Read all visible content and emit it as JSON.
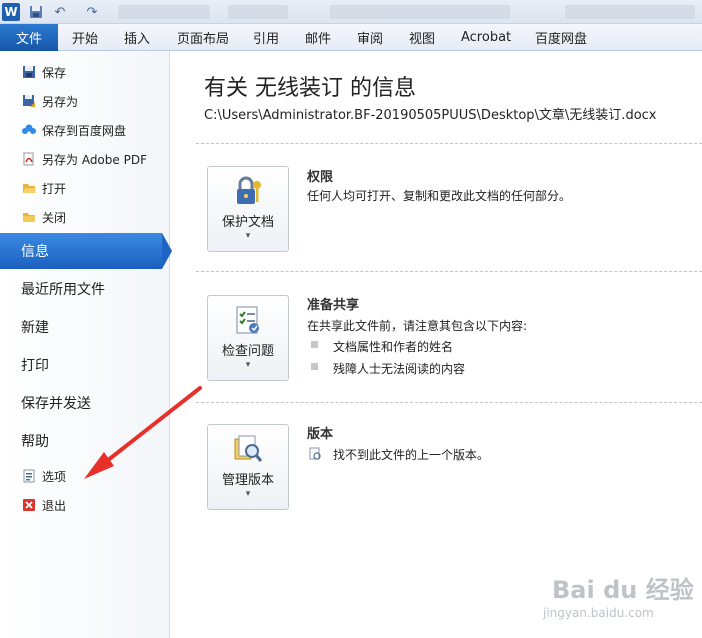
{
  "titlebar": {
    "app_icon": "W",
    "undo_glyph": "↶",
    "redo_glyph": "↷"
  },
  "ribbon": {
    "file_tab": "文件",
    "tabs": [
      "开始",
      "插入",
      "页面布局",
      "引用",
      "邮件",
      "审阅",
      "视图",
      "Acrobat",
      "百度网盘"
    ]
  },
  "nav": {
    "commands_top": [
      {
        "label": "保存",
        "icon": "save-icon"
      },
      {
        "label": "另存为",
        "icon": "save-as-icon"
      },
      {
        "label": "保存到百度网盘",
        "icon": "baidu-cloud-icon"
      },
      {
        "label": "另存为 Adobe PDF",
        "icon": "pdf-icon"
      },
      {
        "label": "打开",
        "icon": "folder-open-icon"
      },
      {
        "label": "关闭",
        "icon": "folder-close-icon"
      }
    ],
    "selected": "信息",
    "big_items": [
      "最近所用文件",
      "新建",
      "打印",
      "保存并发送",
      "帮助"
    ],
    "commands_bottom": [
      {
        "label": "选项",
        "icon": "options-icon"
      },
      {
        "label": "退出",
        "icon": "exit-icon"
      }
    ]
  },
  "main": {
    "title": "有关 无线装订 的信息",
    "path": "C:\\Users\\Administrator.BF-20190505PUUS\\Desktop\\文章\\无线装订.docx",
    "sections": [
      {
        "button_label": "保护文档",
        "button_icon": "lock-key-icon",
        "heading": "权限",
        "text": "任何人均可打开、复制和更改此文档的任何部分。"
      },
      {
        "button_label": "检查问题",
        "button_icon": "checklist-icon",
        "heading": "准备共享",
        "text": "在共享此文件前，请注意其包含以下内容:",
        "bullets": [
          "文档属性和作者的姓名",
          "残障人士无法阅读的内容"
        ]
      },
      {
        "button_label": "管理版本",
        "button_icon": "manage-versions-icon",
        "heading": "版本",
        "text": "找不到此文件的上一个版本。"
      }
    ],
    "dropdown_glyph": "▾"
  },
  "watermark": {
    "text": "Bai du 经验",
    "sub": "jingyan.baidu.com"
  },
  "colors": {
    "file_tab": "#1f63c5",
    "annotation_arrow": "#e8302a"
  }
}
